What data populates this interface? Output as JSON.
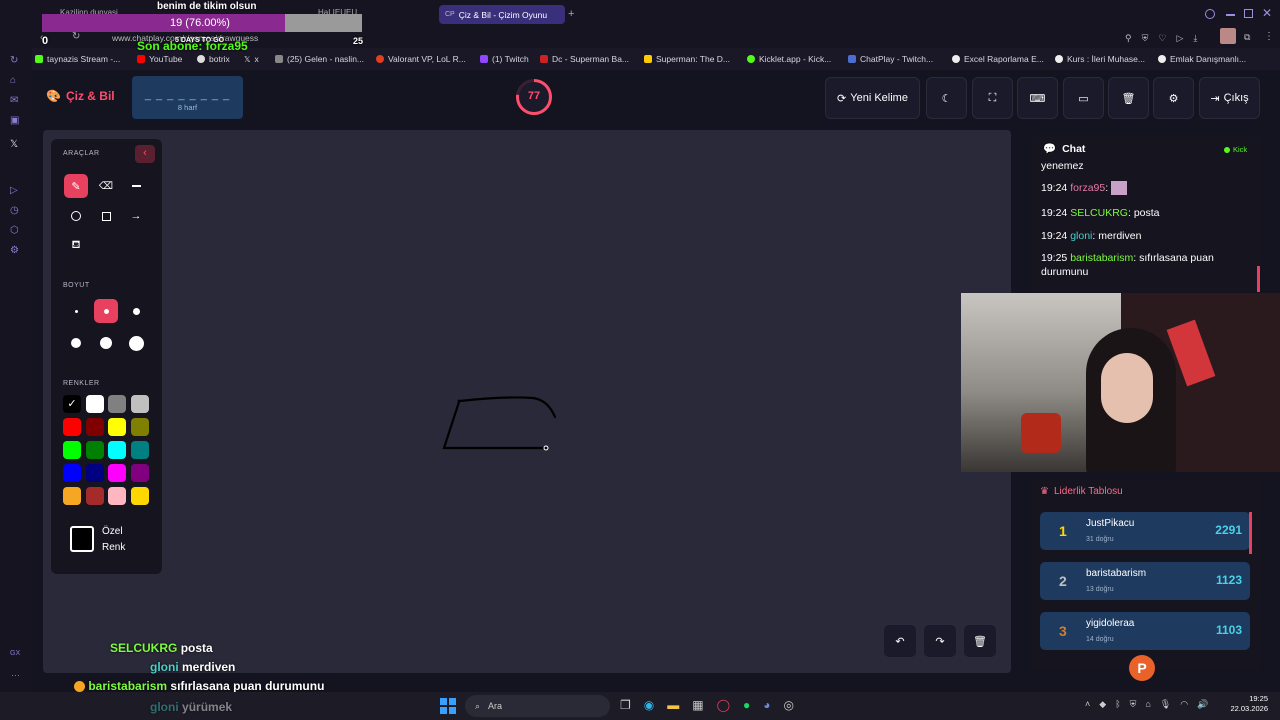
{
  "browser": {
    "tab_active": "Çiz & Bil - Çizim Oyunu",
    "tab_left_1": "Kazilinn dunyasi",
    "tab_left_2": "HaLIEUEU",
    "address": "www.chatplay.com/r/games/drawguess",
    "bookmarks": [
      "taynazis Stream -...",
      "YouTube",
      "botrix",
      "x",
      "(25) Gelen - naslin...",
      "Valorant VP, LoL R...",
      "(1) Twitch",
      "Dc - Superman Ba...",
      "Superman: The D...",
      "Kicklet.app - Kick...",
      "ChatPlay - Twitch...",
      "Excel Raporlama E...",
      "Kurs : İleri Muhase...",
      "Emlak Danışmanlı..."
    ]
  },
  "stream_overlay": {
    "goal_title": "benim de tikim olsun",
    "goal_progress_text": "19 (76.00%)",
    "goal_fraction": 0.76,
    "goal_start": "0",
    "goal_end": "25",
    "goal_sub": "5 DAYS TO GO",
    "last_sub_label": "Son abone: forza95"
  },
  "app": {
    "logo": "Çiz & Bil",
    "word_mask": "_ _ _ _ _ _ _ _",
    "word_hint": "8 harf",
    "timer": "77",
    "timer_fraction": 0.77,
    "new_word_label": "Yeni Kelime",
    "exit_label": "Çıkış"
  },
  "tools": {
    "section_tools": "ARAÇLAR",
    "section_size": "BOYUT",
    "section_colors": "RENKLER",
    "custom_color_label_1": "Özel",
    "custom_color_label_2": "Renk",
    "colors": [
      "#000000",
      "#ffffff",
      "#808080",
      "#c0c0c0",
      "#ff0000",
      "#800000",
      "#ffff00",
      "#808000",
      "#00ff00",
      "#008000",
      "#00ffff",
      "#008080",
      "#0000ff",
      "#000080",
      "#ff00ff",
      "#800080",
      "#f5a623",
      "#a52a2a",
      "#ffb6c1",
      "#ffd700"
    ]
  },
  "chat": {
    "title": "Chat",
    "platform": "Kick",
    "top_fragment": "yenemez",
    "messages": [
      {
        "time": "19:24",
        "user": "forza95",
        "text": "",
        "color": "#e879a8"
      },
      {
        "time": "19:24",
        "user": "SELCUKRG",
        "text": "posta",
        "color": "#7cfc3c"
      },
      {
        "time": "19:24",
        "user": "gloni",
        "text": "merdiven",
        "color": "#4ad0c8"
      },
      {
        "time": "19:25",
        "user": "baristabarism",
        "text": "sıfırlasana puan",
        "text2": "durumunu",
        "color": "#7cfc3c"
      }
    ]
  },
  "leaderboard": {
    "title": "Liderlik Tablosu",
    "rows": [
      {
        "rank": "1",
        "name": "JustPikacu",
        "sub": "31 doğru",
        "score": "2291"
      },
      {
        "rank": "2",
        "name": "baristabarism",
        "sub": "13 doğru",
        "score": "1123"
      },
      {
        "rank": "3",
        "name": "yigidoleraa",
        "sub": "14 doğru",
        "score": "1103"
      }
    ]
  },
  "overlay_chat": [
    {
      "user": "SELCUKRG",
      "text": "posta",
      "color": "#7cfc3c"
    },
    {
      "user": "gloni",
      "text": "merdiven",
      "color": "#4ad0c8"
    },
    {
      "user": "baristabarism",
      "text": "sıfırlasana puan durumunu",
      "color": "#7cfc3c"
    },
    {
      "user": "gloni",
      "text": "yürümek",
      "color": "#4ad0c8"
    }
  ],
  "taskbar": {
    "search_label": "Ara",
    "time": "19:25",
    "date": "22.03.2026"
  }
}
